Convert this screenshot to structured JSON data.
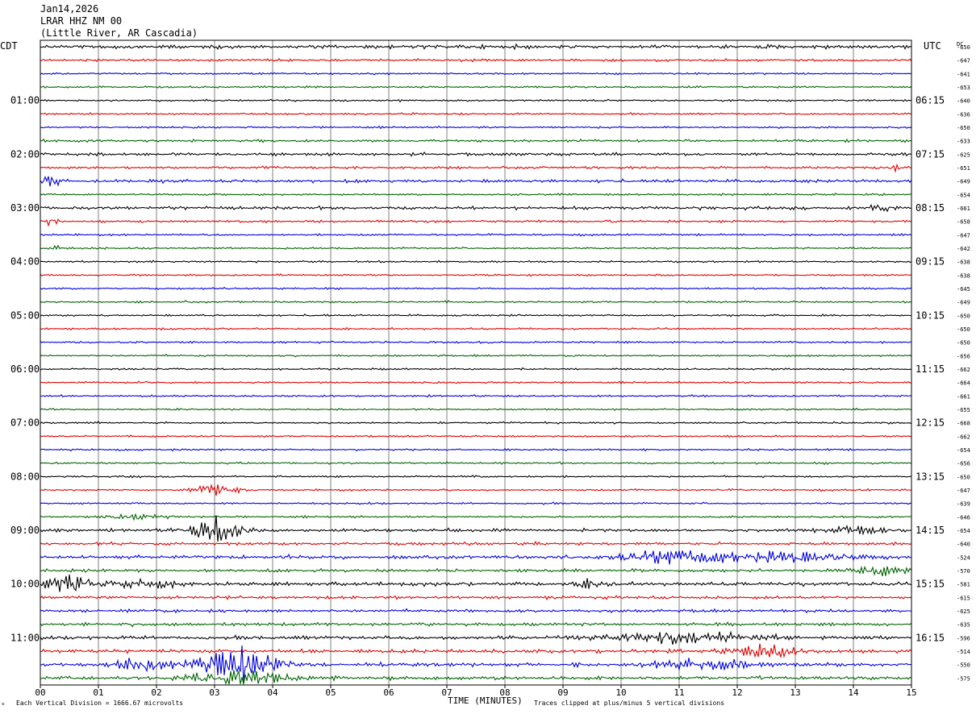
{
  "header": {
    "date": "Jan14,2026",
    "station": "LRAR HHZ NM 00",
    "location": "(Little River, AR Cascadia)"
  },
  "footer": {
    "scale_note": "Each Vertical Division = 1666.67 microvolts",
    "clip_note": "Traces clipped at plus/minus 5 vertical divisions",
    "corner_mark": "ℴ"
  },
  "chart_data": {
    "type": "line",
    "title": "",
    "xlabel": "TIME (MINUTES)",
    "xlim": [
      0,
      15
    ],
    "x_ticks": [
      "00",
      "01",
      "02",
      "03",
      "04",
      "05",
      "06",
      "07",
      "08",
      "09",
      "10",
      "11",
      "12",
      "13",
      "14",
      "15"
    ],
    "left_axis_label": "CDT",
    "right_axis_label": "UTC",
    "dc_label": "DC",
    "left_hours": [
      "01:00",
      "02:00",
      "03:00",
      "04:00",
      "05:00",
      "06:00",
      "07:00",
      "08:00",
      "09:00",
      "10:00",
      "11:00"
    ],
    "right_hours": [
      "06:15",
      "07:15",
      "08:15",
      "09:15",
      "10:15",
      "11:15",
      "12:15",
      "13:15",
      "14:15",
      "15:15",
      "16:15"
    ],
    "trace_colors": [
      "#000000",
      "#e00000",
      "#0000e0",
      "#006400"
    ],
    "dc_offsets": [
      "-650",
      "-647",
      "-641",
      "-653",
      "-640",
      "-636",
      "-650",
      "-633",
      "-625",
      "-651",
      "-649",
      "-654",
      "-661",
      "-658",
      "-647",
      "-642",
      "-638",
      "-638",
      "-645",
      "-649",
      "-650",
      "-650",
      "-650",
      "-656",
      "-662",
      "-664",
      "-661",
      "-655",
      "-668",
      "-662",
      "-654",
      "-656",
      "-650",
      "-647",
      "-639",
      "-646",
      "-654",
      "-640",
      "-524",
      "-570",
      "-581",
      "-615",
      "-625",
      "-635",
      "-596",
      "-514",
      "-550",
      "-575"
    ],
    "trace_amplitude": [
      6,
      4,
      3,
      3,
      3,
      3,
      3,
      4,
      5,
      4,
      5,
      3,
      5,
      4,
      3,
      3,
      3,
      3,
      3,
      3,
      3,
      3,
      3,
      3,
      3,
      3,
      3,
      3,
      3,
      3,
      3,
      3,
      3,
      3,
      3,
      3,
      5,
      5,
      6,
      5,
      6,
      5,
      5,
      5,
      6,
      6,
      6,
      6
    ],
    "events": [
      {
        "trace": 9,
        "t": 14.6,
        "amp": 10,
        "w": 0.25
      },
      {
        "trace": 10,
        "t": 0.2,
        "amp": 9,
        "w": 0.35
      },
      {
        "trace": 12,
        "t": 14.5,
        "amp": 8,
        "w": 0.4
      },
      {
        "trace": 13,
        "t": 0.2,
        "amp": 8,
        "w": 0.3
      },
      {
        "trace": 15,
        "t": 0.2,
        "amp": 7,
        "w": 0.3
      },
      {
        "trace": 33,
        "t": 3.0,
        "amp": 14,
        "w": 0.6
      },
      {
        "trace": 35,
        "t": 1.7,
        "amp": 6,
        "w": 0.8
      },
      {
        "trace": 36,
        "t": 3.0,
        "amp": 30,
        "w": 0.7
      },
      {
        "trace": 36,
        "t": 14.0,
        "amp": 8,
        "w": 0.8
      },
      {
        "trace": 38,
        "t": 11.0,
        "amp": 16,
        "w": 1.5
      },
      {
        "trace": 38,
        "t": 13.0,
        "amp": 9,
        "w": 1.5
      },
      {
        "trace": 39,
        "t": 14.5,
        "amp": 10,
        "w": 0.8
      },
      {
        "trace": 40,
        "t": 0.5,
        "amp": 16,
        "w": 0.8
      },
      {
        "trace": 40,
        "t": 1.8,
        "amp": 10,
        "w": 0.8
      },
      {
        "trace": 40,
        "t": 9.5,
        "amp": 10,
        "w": 0.4
      },
      {
        "trace": 44,
        "t": 11.0,
        "amp": 12,
        "w": 2.0
      },
      {
        "trace": 45,
        "t": 12.5,
        "amp": 16,
        "w": 0.8
      },
      {
        "trace": 46,
        "t": 1.7,
        "amp": 18,
        "w": 0.6
      },
      {
        "trace": 46,
        "t": 3.4,
        "amp": 40,
        "w": 1.0
      },
      {
        "trace": 46,
        "t": 11.5,
        "amp": 10,
        "w": 1.5
      },
      {
        "trace": 47,
        "t": 3.4,
        "amp": 18,
        "w": 1.2
      }
    ]
  }
}
